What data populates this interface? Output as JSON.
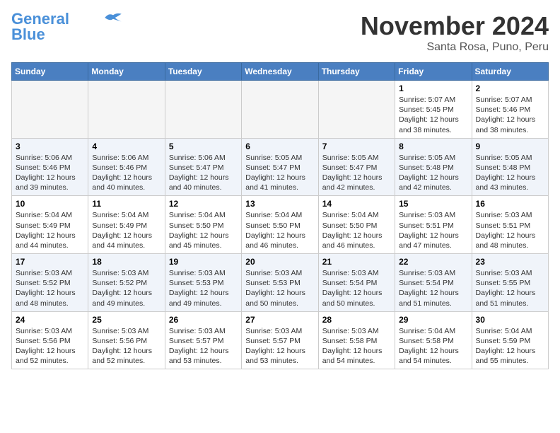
{
  "header": {
    "logo_line1": "General",
    "logo_line2": "Blue",
    "month": "November 2024",
    "location": "Santa Rosa, Puno, Peru"
  },
  "weekdays": [
    "Sunday",
    "Monday",
    "Tuesday",
    "Wednesday",
    "Thursday",
    "Friday",
    "Saturday"
  ],
  "weeks": [
    [
      {
        "day": "",
        "info": ""
      },
      {
        "day": "",
        "info": ""
      },
      {
        "day": "",
        "info": ""
      },
      {
        "day": "",
        "info": ""
      },
      {
        "day": "",
        "info": ""
      },
      {
        "day": "1",
        "info": "Sunrise: 5:07 AM\nSunset: 5:45 PM\nDaylight: 12 hours and 38 minutes."
      },
      {
        "day": "2",
        "info": "Sunrise: 5:07 AM\nSunset: 5:46 PM\nDaylight: 12 hours and 38 minutes."
      }
    ],
    [
      {
        "day": "3",
        "info": "Sunrise: 5:06 AM\nSunset: 5:46 PM\nDaylight: 12 hours and 39 minutes."
      },
      {
        "day": "4",
        "info": "Sunrise: 5:06 AM\nSunset: 5:46 PM\nDaylight: 12 hours and 40 minutes."
      },
      {
        "day": "5",
        "info": "Sunrise: 5:06 AM\nSunset: 5:47 PM\nDaylight: 12 hours and 40 minutes."
      },
      {
        "day": "6",
        "info": "Sunrise: 5:05 AM\nSunset: 5:47 PM\nDaylight: 12 hours and 41 minutes."
      },
      {
        "day": "7",
        "info": "Sunrise: 5:05 AM\nSunset: 5:47 PM\nDaylight: 12 hours and 42 minutes."
      },
      {
        "day": "8",
        "info": "Sunrise: 5:05 AM\nSunset: 5:48 PM\nDaylight: 12 hours and 42 minutes."
      },
      {
        "day": "9",
        "info": "Sunrise: 5:05 AM\nSunset: 5:48 PM\nDaylight: 12 hours and 43 minutes."
      }
    ],
    [
      {
        "day": "10",
        "info": "Sunrise: 5:04 AM\nSunset: 5:49 PM\nDaylight: 12 hours and 44 minutes."
      },
      {
        "day": "11",
        "info": "Sunrise: 5:04 AM\nSunset: 5:49 PM\nDaylight: 12 hours and 44 minutes."
      },
      {
        "day": "12",
        "info": "Sunrise: 5:04 AM\nSunset: 5:50 PM\nDaylight: 12 hours and 45 minutes."
      },
      {
        "day": "13",
        "info": "Sunrise: 5:04 AM\nSunset: 5:50 PM\nDaylight: 12 hours and 46 minutes."
      },
      {
        "day": "14",
        "info": "Sunrise: 5:04 AM\nSunset: 5:50 PM\nDaylight: 12 hours and 46 minutes."
      },
      {
        "day": "15",
        "info": "Sunrise: 5:03 AM\nSunset: 5:51 PM\nDaylight: 12 hours and 47 minutes."
      },
      {
        "day": "16",
        "info": "Sunrise: 5:03 AM\nSunset: 5:51 PM\nDaylight: 12 hours and 48 minutes."
      }
    ],
    [
      {
        "day": "17",
        "info": "Sunrise: 5:03 AM\nSunset: 5:52 PM\nDaylight: 12 hours and 48 minutes."
      },
      {
        "day": "18",
        "info": "Sunrise: 5:03 AM\nSunset: 5:52 PM\nDaylight: 12 hours and 49 minutes."
      },
      {
        "day": "19",
        "info": "Sunrise: 5:03 AM\nSunset: 5:53 PM\nDaylight: 12 hours and 49 minutes."
      },
      {
        "day": "20",
        "info": "Sunrise: 5:03 AM\nSunset: 5:53 PM\nDaylight: 12 hours and 50 minutes."
      },
      {
        "day": "21",
        "info": "Sunrise: 5:03 AM\nSunset: 5:54 PM\nDaylight: 12 hours and 50 minutes."
      },
      {
        "day": "22",
        "info": "Sunrise: 5:03 AM\nSunset: 5:54 PM\nDaylight: 12 hours and 51 minutes."
      },
      {
        "day": "23",
        "info": "Sunrise: 5:03 AM\nSunset: 5:55 PM\nDaylight: 12 hours and 51 minutes."
      }
    ],
    [
      {
        "day": "24",
        "info": "Sunrise: 5:03 AM\nSunset: 5:56 PM\nDaylight: 12 hours and 52 minutes."
      },
      {
        "day": "25",
        "info": "Sunrise: 5:03 AM\nSunset: 5:56 PM\nDaylight: 12 hours and 52 minutes."
      },
      {
        "day": "26",
        "info": "Sunrise: 5:03 AM\nSunset: 5:57 PM\nDaylight: 12 hours and 53 minutes."
      },
      {
        "day": "27",
        "info": "Sunrise: 5:03 AM\nSunset: 5:57 PM\nDaylight: 12 hours and 53 minutes."
      },
      {
        "day": "28",
        "info": "Sunrise: 5:03 AM\nSunset: 5:58 PM\nDaylight: 12 hours and 54 minutes."
      },
      {
        "day": "29",
        "info": "Sunrise: 5:04 AM\nSunset: 5:58 PM\nDaylight: 12 hours and 54 minutes."
      },
      {
        "day": "30",
        "info": "Sunrise: 5:04 AM\nSunset: 5:59 PM\nDaylight: 12 hours and 55 minutes."
      }
    ]
  ]
}
